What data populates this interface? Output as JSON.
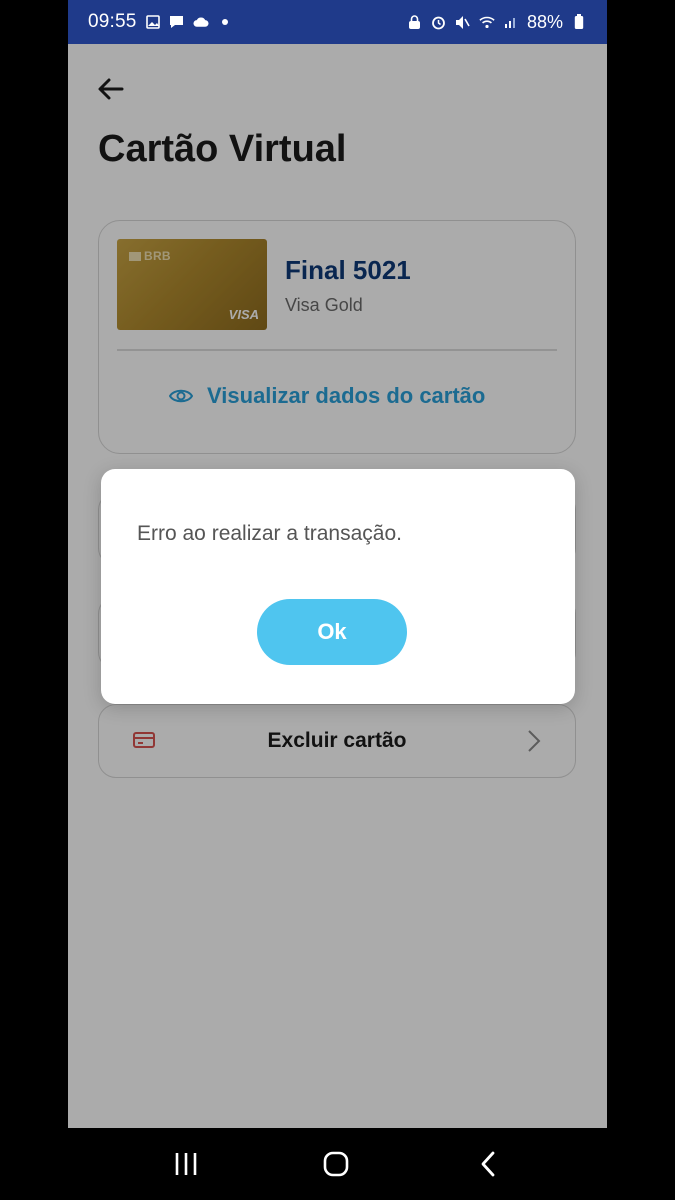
{
  "status_bar": {
    "time": "09:55",
    "battery": "88%",
    "left_icons": [
      "gallery-icon",
      "chat-icon",
      "cloud-icon",
      "dot-icon"
    ],
    "right_icons": [
      "lock-icon",
      "alarm-icon",
      "mute-icon",
      "wifi-icon",
      "signal-icon",
      "battery-icon"
    ]
  },
  "page": {
    "title": "Cartão Virtual",
    "back_icon": "back-arrow-icon"
  },
  "card": {
    "brand_logo": "BRB",
    "network": "VISA",
    "final": "Final 5021",
    "type": "Visa Gold",
    "view_data_label": "Visualizar dados do cartão"
  },
  "actions": {
    "delete_card_label": "Excluir cartão"
  },
  "dialog": {
    "message": "Erro ao realizar a transação.",
    "ok_label": "Ok"
  },
  "colors": {
    "status_bar": "#1f3a8a",
    "title_navy": "#0e3a78",
    "link_blue": "#2aa0d8",
    "ok_button": "#4fc5ef",
    "delete_icon": "#d9534f"
  },
  "nav_bar": {
    "icons": [
      "recent-apps-icon",
      "home-icon",
      "back-icon"
    ]
  }
}
